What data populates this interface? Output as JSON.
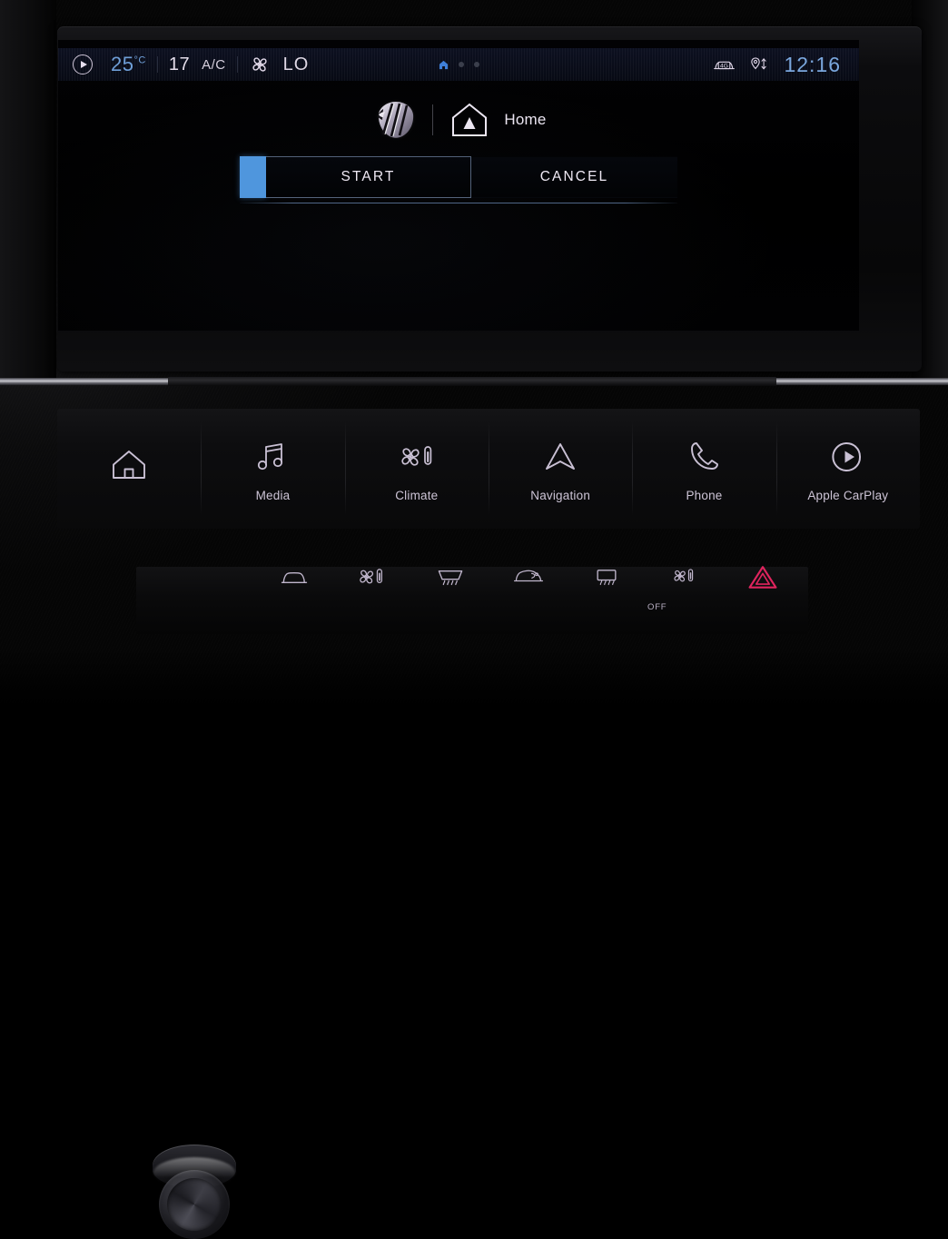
{
  "status_bar": {
    "carplay_icon": "carplay-play-circle-icon",
    "temperature": "25",
    "temperature_unit": "°C",
    "fan_speed": "17",
    "ac_label": "A/C",
    "fan_icon": "fan-icon",
    "mode_label": "LO",
    "network_icon": "car-4g-icon",
    "network_label": "4G",
    "location_icon": "location-pin-arrows-icon",
    "clock": "12:16",
    "page_dots": [
      {
        "type": "home",
        "active": true
      },
      {
        "type": "dot",
        "active": false
      },
      {
        "type": "dot",
        "active": false
      }
    ],
    "accent_color": "#6f9fd8",
    "clock_color": "#7aa7de"
  },
  "widget": {
    "brand_logo": "peugeot-lion-logo",
    "destination_icon": "home-house-nav-icon",
    "destination_label": "Home",
    "buttons": {
      "start_label": "START",
      "cancel_label": "CANCEL"
    },
    "accent_color": "#4f96dd"
  },
  "toolbar": {
    "items": [
      {
        "icon": "home-icon",
        "label": ""
      },
      {
        "icon": "music-note-icon",
        "label": "Media"
      },
      {
        "icon": "fan-thermometer-icon",
        "label": "Climate"
      },
      {
        "icon": "navigation-arrow-icon",
        "label": "Navigation"
      },
      {
        "icon": "phone-handset-icon",
        "label": "Phone"
      },
      {
        "icon": "carplay-icon",
        "label": "Apple CarPlay"
      }
    ]
  },
  "hardware_buttons": {
    "items": [
      {
        "icon": "air-recirculation-icon",
        "label": ""
      },
      {
        "icon": "fan-thermometer-icon",
        "label": ""
      },
      {
        "icon": "front-defrost-icon",
        "label": ""
      },
      {
        "icon": "rear-air-icon",
        "label": ""
      },
      {
        "icon": "rear-defrost-icon",
        "label": ""
      },
      {
        "icon": "climate-off-icon",
        "label": "OFF"
      },
      {
        "icon": "hazard-triangle-icon",
        "label": "",
        "color": "#e0245e"
      }
    ],
    "knob": "volume-knob"
  }
}
